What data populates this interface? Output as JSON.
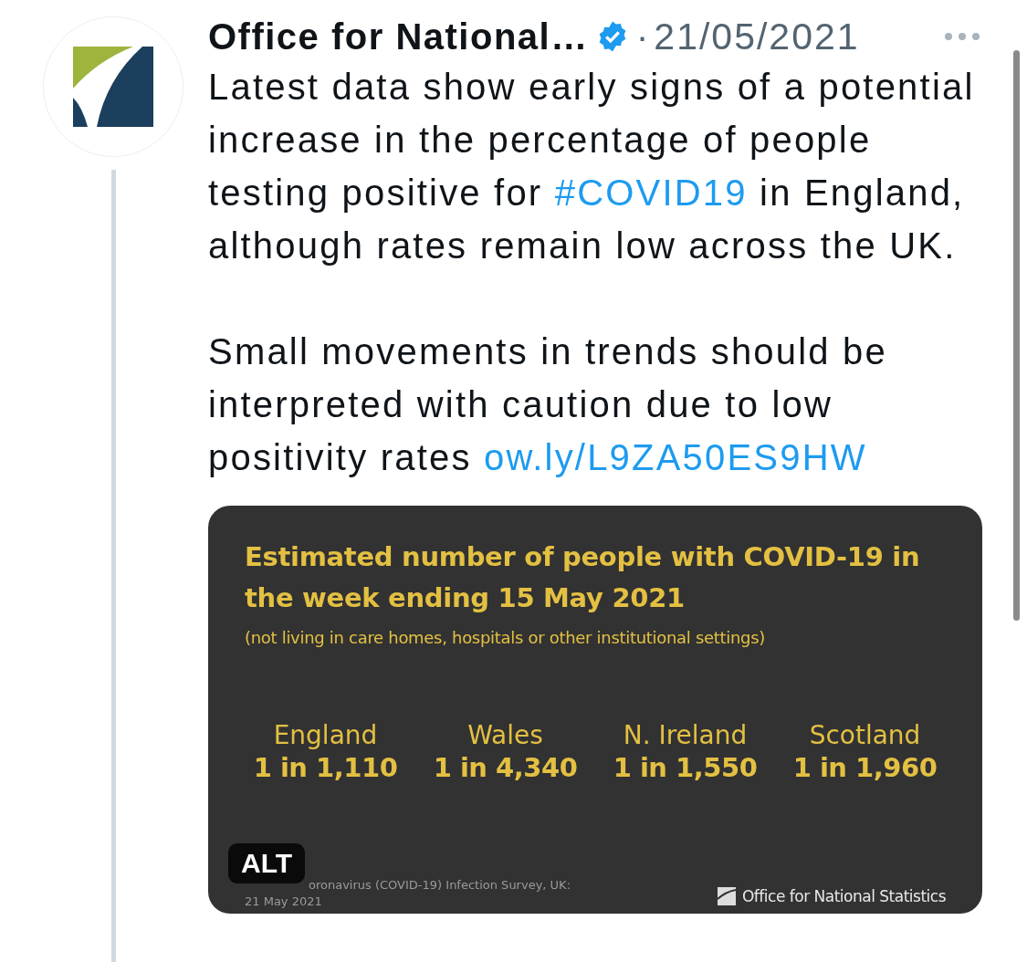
{
  "tweet": {
    "author": {
      "name": "Office for National…",
      "verified": true
    },
    "separator": "·",
    "date": "21/05/2021",
    "paragraphs": [
      [
        {
          "kind": "plain",
          "text": "Latest data show early signs of a potential increase in the percentage of people testing positive for "
        },
        {
          "kind": "hashtag",
          "text": "#COVID19"
        },
        {
          "kind": "plain",
          "text": " in England, although rates remain low across the UK."
        }
      ],
      [
        {
          "kind": "plain",
          "text": "Small movements in trends should be interpreted with caution due to low positivity rates "
        },
        {
          "kind": "link",
          "text": "ow.ly/L9ZA50ES9HW"
        }
      ]
    ],
    "media": {
      "title": "Estimated number of people with COVID-19 in the week ending 15 May 2021",
      "subtitle": "(not living in care homes, hospitals or other institutional settings)",
      "regions": [
        {
          "name": "England",
          "value": "1 in 1,110"
        },
        {
          "name": "Wales",
          "value": "1 in 4,340"
        },
        {
          "name": "N. Ireland",
          "value": "1 in 1,550"
        },
        {
          "name": "Scotland",
          "value": "1 in 1,960"
        }
      ],
      "source": [
        "oronavirus (COVID-19) Infection Survey, UK:",
        "21 May 2021"
      ],
      "brand": "Office for National Statistics",
      "alt_badge": "ALT"
    }
  }
}
